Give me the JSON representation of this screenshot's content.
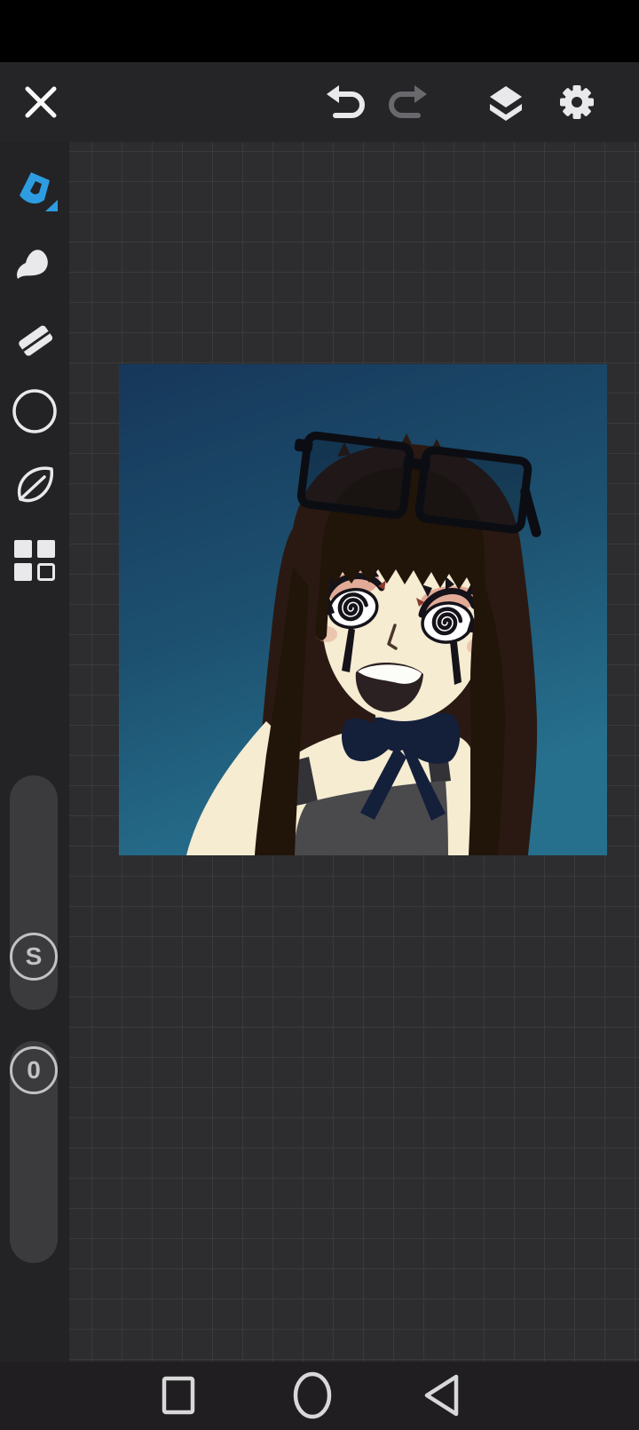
{
  "ui": {
    "topbar": {
      "close_icon": "close",
      "undo_icon": "undo",
      "redo_icon": "redo",
      "layers_icon": "layers",
      "settings_icon": "settings"
    },
    "sidebar": {
      "tools": [
        {
          "id": "paint-brush",
          "selected": true
        },
        {
          "id": "smudge",
          "selected": false
        },
        {
          "id": "eraser",
          "selected": false
        },
        {
          "id": "color-circle",
          "selected": false
        },
        {
          "id": "leaf-stabilizer",
          "selected": false
        },
        {
          "id": "layout-squares",
          "selected": false
        }
      ],
      "sliders": [
        {
          "id": "size-slider",
          "label": "S"
        },
        {
          "id": "opacity-slider",
          "label": "0"
        }
      ]
    },
    "navbar": {
      "buttons": [
        "recents",
        "home",
        "back"
      ]
    }
  },
  "colors": {
    "statusbar": "#000000",
    "chrome": "#252527",
    "sidebar": "#232325",
    "canvasBg": "#2d2d2f",
    "gridLine": "#3a3a3d",
    "navbar": "#201e21",
    "accent": "#2d9ce0",
    "icon": "#e9e9eb",
    "iconDim": "#69696d",
    "divider": "#3f3f42",
    "sliderTrack": "#3b3b3e",
    "sliderFg": "#c2c2c6",
    "navIcon": "#d8d8d8"
  },
  "artwork": {
    "bgTop": "#16375a",
    "bgMid": "#1d5170",
    "bgBottom": "#26708e",
    "hair": "#2a1912",
    "hairFront": "#211409",
    "skin": "#f5ecd1",
    "neckShadow": "#e9dcbd",
    "bow": "#141f3a",
    "garment": "#4a4a4d",
    "strap": "#323237",
    "mouth": "#2b2022",
    "teeth": "#fcfcf8",
    "glasses": "#0b0d13",
    "lash": "#15121a",
    "blush": "#dfa08d",
    "redAccent": "#8a3a30",
    "noseLine": "#4a372b"
  }
}
